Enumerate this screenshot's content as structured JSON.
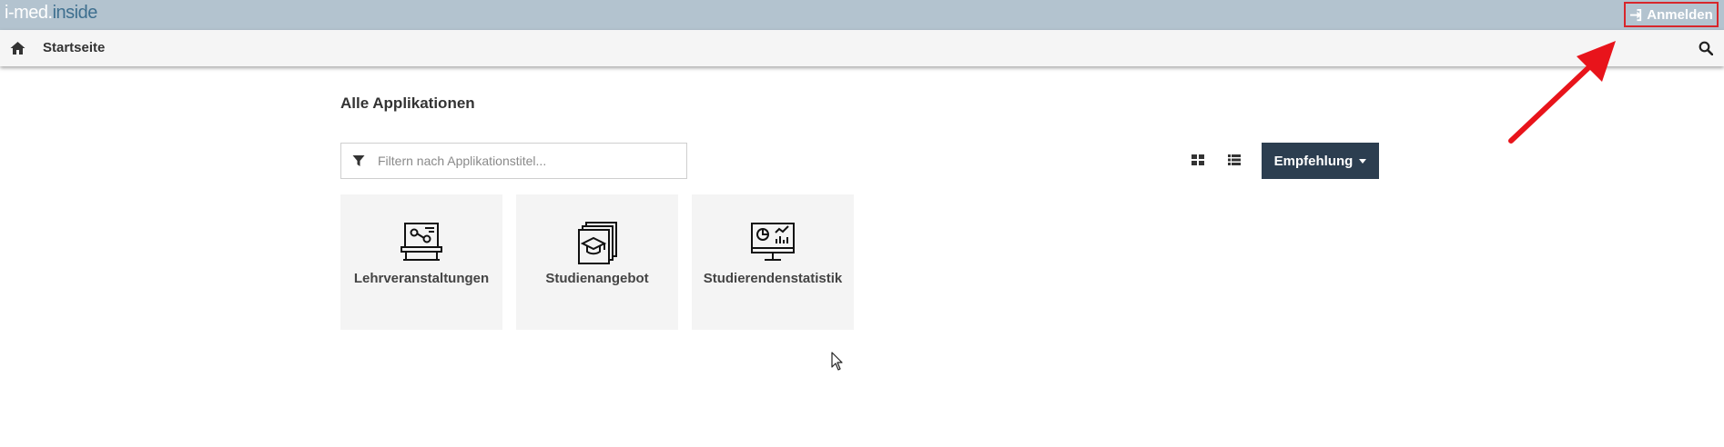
{
  "header": {
    "logo_part1": "i-med.",
    "logo_part2": "inside",
    "login_label": "Anmelden",
    "highlight_color": "#d8262b"
  },
  "navbar": {
    "home_label": "Startseite",
    "home_icon": "home-icon",
    "search_icon": "search-icon"
  },
  "main": {
    "title": "Alle Applikationen",
    "filter_placeholder": "Filtern nach Applikationstitel...",
    "filter_value": "",
    "sort_label": "Empfehlung",
    "view_grid_icon": "grid-view-icon",
    "view_list_icon": "list-view-icon",
    "tiles": [
      {
        "label": "Lehrveranstaltungen",
        "icon": "classroom-icon"
      },
      {
        "label": "Studienangebot",
        "icon": "graduation-cap-icon"
      },
      {
        "label": "Studierendenstatistik",
        "icon": "statistics-monitor-icon"
      }
    ]
  },
  "colors": {
    "topbar": "#b3c3cf",
    "navbar": "#f5f5f5",
    "button_dark": "#2c3e50",
    "tile_bg": "#f4f4f4",
    "annotation_arrow": "#e8141b"
  }
}
